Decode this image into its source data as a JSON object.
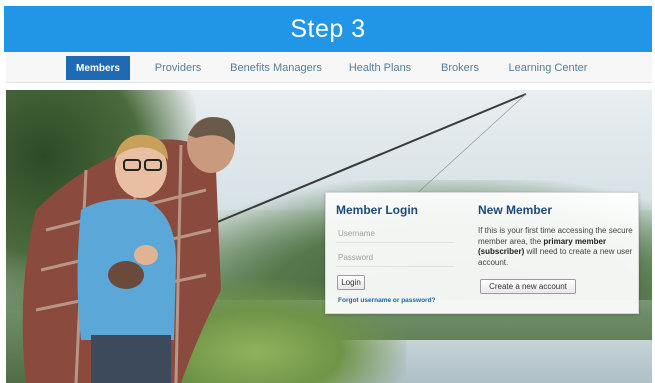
{
  "banner": {
    "title": "Step 3"
  },
  "nav": {
    "items": [
      {
        "label": "Members",
        "active": true
      },
      {
        "label": "Providers",
        "active": false
      },
      {
        "label": "Benefits Managers",
        "active": false
      },
      {
        "label": "Health Plans",
        "active": false
      },
      {
        "label": "Brokers",
        "active": false
      },
      {
        "label": "Learning Center",
        "active": false
      }
    ]
  },
  "login": {
    "title": "Member Login",
    "username_placeholder": "Username",
    "password_placeholder": "Password",
    "login_button": "Login",
    "forgot_link": "Forgot username or password?"
  },
  "new_member": {
    "title": "New Member",
    "text_before": "If this is your first time accessing the secure member area, the ",
    "text_bold": "primary member (subscriber)",
    "text_after": " will need to create a new user account.",
    "create_button": "Create a new account"
  },
  "colors": {
    "banner": "#2196e6",
    "nav_active": "#1f6bb3",
    "link": "#1f5fa8",
    "heading": "#1d4a78"
  }
}
